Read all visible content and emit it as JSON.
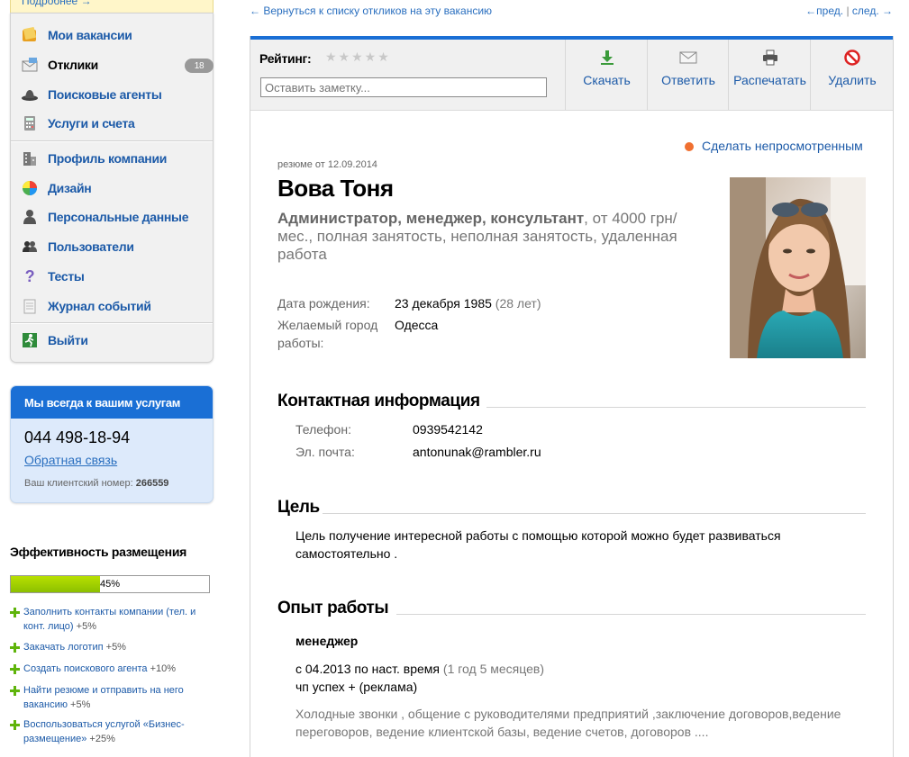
{
  "sidebar": {
    "top_link": "Подробнее →",
    "nav": [
      {
        "label": "Мои вакансии",
        "icon": "folder-icon"
      },
      {
        "label": "Отклики",
        "icon": "envelope-icon",
        "badge": "18",
        "active": true
      },
      {
        "label": "Поисковые агенты",
        "icon": "hat-icon"
      },
      {
        "label": "Услуги и счета",
        "icon": "calculator-icon"
      },
      {
        "label": "Профиль компании",
        "icon": "building-icon"
      },
      {
        "label": "Дизайн",
        "icon": "palette-icon"
      },
      {
        "label": "Персональные данные",
        "icon": "person-icon"
      },
      {
        "label": "Пользователи",
        "icon": "users-icon"
      },
      {
        "label": "Тесты",
        "icon": "question-icon"
      },
      {
        "label": "Журнал событий",
        "icon": "notepad-icon"
      },
      {
        "label": "Выйти",
        "icon": "exit-icon"
      }
    ],
    "service": {
      "title": "Мы всегда к вашим услугам",
      "phone": "044 498-18-94",
      "feedback": "Обратная связь",
      "client_label": "Ваш клиентский номер:",
      "client_number": "266559"
    },
    "efficiency": {
      "title": "Эффективность размещения",
      "percent": 45,
      "percent_text": "45%",
      "tips": [
        {
          "text": "Заполнить контакты компании (тел. и конт. лицо)",
          "bonus": "+5%"
        },
        {
          "text": "Закачать логотип",
          "bonus": "+5%"
        },
        {
          "text": "Создать поискового агента",
          "bonus": "+10%"
        },
        {
          "text": "Найти резюме и отправить на него вакансию",
          "bonus": "+5%"
        },
        {
          "text": "Воспользоваться услугой «Бизнес-размещение»",
          "bonus": "+25%"
        }
      ]
    }
  },
  "nav_links": {
    "back": "← Вернуться к списку откликов на эту вакансию",
    "prev": "←пред.",
    "sep": "|",
    "next": "след. →"
  },
  "toolbar": {
    "rating_label": "Рейтинг:",
    "stars": "★★★★★",
    "note_placeholder": "Оставить заметку...",
    "download": "Скачать",
    "reply": "Ответить",
    "print": "Распечатать",
    "delete": "Удалить"
  },
  "resume": {
    "mark_unviewed": "Сделать непросмотренным",
    "date": "резюме от 12.09.2014",
    "name": "Вова Тоня",
    "position": "Администратор, менеджер, консультант",
    "position_rest": ", от 4000 грн/мес., полная занятость, неполная занятость, удаленная работа",
    "birth_label": "Дата рождения:",
    "birth_value": "23 декабря 1985",
    "birth_age": "(28 лет)",
    "city_label": "Желаемый город работы:",
    "city_value": "Одесса"
  },
  "contacts": {
    "title": "Контактная информация",
    "phone_label": "Телефон:",
    "phone_value": "0939542142",
    "email_label": "Эл. почта:",
    "email_value": "antonunak@rambler.ru"
  },
  "goal": {
    "title": "Цель",
    "text": "Цель получение интересной работы с помощью которой можно будет развиваться самостоятельно ."
  },
  "experience": {
    "title": "Опыт работы",
    "job_title": "менеджер",
    "period": "с 04.2013 по наст. время",
    "duration": "(1 год 5 месяцев)",
    "company": "чп успех + (реклама)",
    "description": "Холодные звонки , общение с руководителями предприятий ,заключение договоров,ведение переговоров, ведение клиентской базы, ведение счетов, договоров ...."
  }
}
